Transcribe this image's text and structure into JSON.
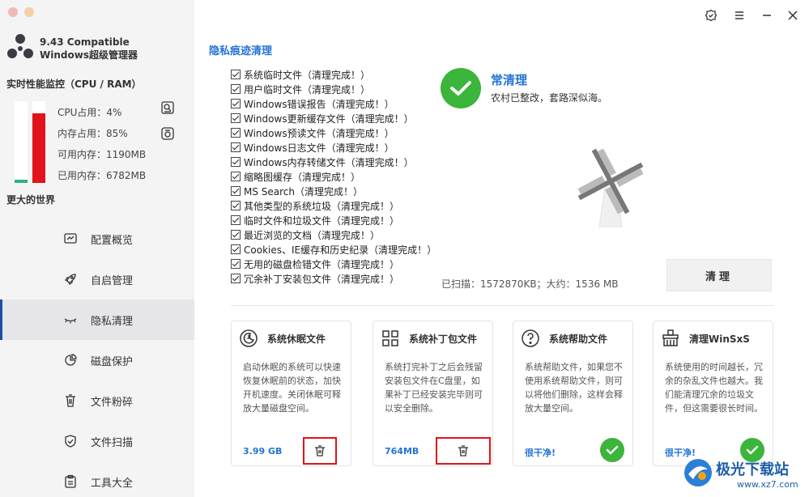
{
  "app": {
    "title_line1": "9.43 Compatible",
    "title_line2": "Windows超级管理器"
  },
  "monitor": {
    "title": "实时性能监控（CPU / RAM）",
    "cpu_percent": 4,
    "mem_percent": 85,
    "cpu_label": "CPU占用：4%",
    "mem_label": "内存占用：85%",
    "avail_label": "可用内存：1190MB",
    "used_label": "已用内存：6782MB",
    "footer": "更大的世界"
  },
  "nav": [
    {
      "label": "配置概览",
      "icon": "chart-icon"
    },
    {
      "label": "自启管理",
      "icon": "rocket-icon"
    },
    {
      "label": "隐私清理",
      "icon": "eye-closed-icon",
      "active": true
    },
    {
      "label": "磁盘保护",
      "icon": "pie-icon"
    },
    {
      "label": "文件粉碎",
      "icon": "trash-icon"
    },
    {
      "label": "文件扫描",
      "icon": "shield-icon"
    },
    {
      "label": "工具大全",
      "icon": "clipboard-icon"
    }
  ],
  "main": {
    "section_title": "隐私痕迹清理",
    "items": [
      "系统临时文件（清理完成！）",
      "用户临时文件（清理完成！）",
      "Windows错误报告（清理完成！）",
      "Windows更新缓存文件（清理完成！）",
      "Windows预读文件（清理完成！）",
      "Windows日志文件（清理完成！）",
      "Windows内存转储文件（清理完成！）",
      "缩略图缓存（清理完成！）",
      "MS Search（清理完成！）",
      "其他类型的系统垃圾（清理完成！）",
      "临时文件和垃圾文件（清理完成！）",
      "最近浏览的文档（清理完成！）",
      "Cookies、IE缓存和历史纪录（清理完成！）",
      "无用的磁盘检错文件（清理完成！）",
      "冗余补丁安装包文件（清理完成！）"
    ],
    "status_title": "常清理",
    "status_sub": "农村已整改，套路深似海。",
    "scan_info": "已扫描：1572870KB；大约：1536 MB",
    "clean_button": "清理"
  },
  "cards": [
    {
      "title": "系统休眠文件",
      "desc": "启动休眠的系统可以快速恢复休眠前的状态，加快开机速度。关闭休眠可释放大量磁盘空间。",
      "footer": "3.99 GB",
      "icon": "sleep-icon"
    },
    {
      "title": "系统补丁包文件",
      "desc": "系统打完补丁之后会残留安装包文件在C盘里，如果补丁已经安装完毕则可以安全删除。",
      "footer": "764MB",
      "icon": "windows-icon"
    },
    {
      "title": "系统帮助文件",
      "desc": "系统帮助文件，如果您不使用系统帮助文件，则可以将他们删除，这样会释放大量空间。",
      "footer": "很干净!",
      "icon": "help-icon"
    },
    {
      "title": "清理WinSxS",
      "desc": "系统使用的时间越长，冗余的杂乱文件也越大。我们能清理冗余的垃圾文件，但这需要很长时间。",
      "footer": "很干净!",
      "icon": "broom-icon"
    }
  ],
  "watermark": {
    "title": "极光下载站",
    "url": "www.xz7.com"
  }
}
